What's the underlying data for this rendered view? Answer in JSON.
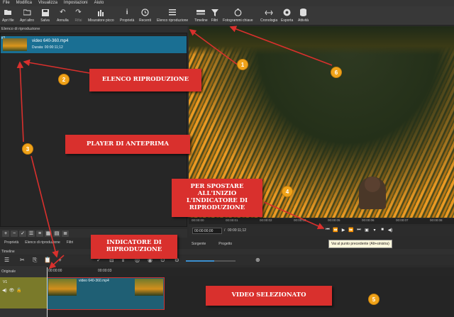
{
  "menu": [
    "File",
    "Modifica",
    "Visualizza",
    "Impostazioni",
    "Aiuto"
  ],
  "toolbar": [
    {
      "label": "Apri file",
      "icon": "folder-open-icon"
    },
    {
      "label": "Apri altro",
      "icon": "folder-icon"
    },
    {
      "label": "Salva",
      "icon": "save-icon"
    },
    {
      "label": "Annulla",
      "icon": "undo-icon"
    },
    {
      "label": "Rifai",
      "icon": "redo-icon",
      "disabled": true
    },
    {
      "label": "Misuratore picco",
      "icon": "peak-meter-icon"
    },
    {
      "label": "Proprietà",
      "icon": "info-icon"
    },
    {
      "label": "Recenti",
      "icon": "clock-icon"
    },
    {
      "label": "Elenco riproduzione",
      "icon": "list-icon"
    },
    {
      "label": "Timeline",
      "icon": "timeline-icon"
    },
    {
      "label": "Filtri",
      "icon": "filter-icon"
    },
    {
      "label": "Fotogrammi chiave",
      "icon": "stopwatch-icon"
    },
    {
      "label": "Cronologia",
      "icon": "history-icon"
    },
    {
      "label": "Esporta",
      "icon": "export-icon"
    },
    {
      "label": "Attività",
      "icon": "database-icon"
    }
  ],
  "playlist": {
    "title": "Elenco di riproduzione",
    "clip_index": "#1",
    "clip_name": "video 640-360.mp4",
    "clip_duration": "Durata: 00:00:11;12",
    "tabs": [
      "Proprietà",
      "Elenco di riproduzione",
      "Filtri"
    ]
  },
  "player": {
    "timecode_current": "00:00:00;00",
    "timecode_sep": "/",
    "timecode_total": "00:00:11;12",
    "ruler_ticks": [
      "00:00:00",
      "00:00:01",
      "00:00:02",
      "00:00:03",
      "00:00:05",
      "00:00:06",
      "00:00:07",
      "00:00:08"
    ],
    "tabs": [
      "Sorgente",
      "Progetto"
    ],
    "tooltip": "Vai al punto precedente (Alt+sinistra)"
  },
  "timeline": {
    "title": "Timeline",
    "original_label": "Originale",
    "track_label": "V1",
    "ruler_ticks": [
      "00:00:00",
      "00:00:03"
    ],
    "clip_title": "video 640-360.mp4"
  },
  "annotations": {
    "elenco": "ELENCO RIPRODUZIONE",
    "player": "PLAYER DI ANTEPRIMA",
    "indicatore": "INDICATORE DI RIPRODUZIONE",
    "spostare": "PER SPOSTARE ALL'INIZIO L'INDICATORE DI RIPRODUZIONE",
    "video": "VIDEO SELEZIONATO",
    "n1": "1",
    "n2": "2",
    "n3": "3",
    "n4": "4",
    "n5": "5",
    "n6": "6"
  },
  "colors": {
    "annotation": "#d9302d",
    "badge": "#f0a31a",
    "selection": "#1a6f93"
  }
}
